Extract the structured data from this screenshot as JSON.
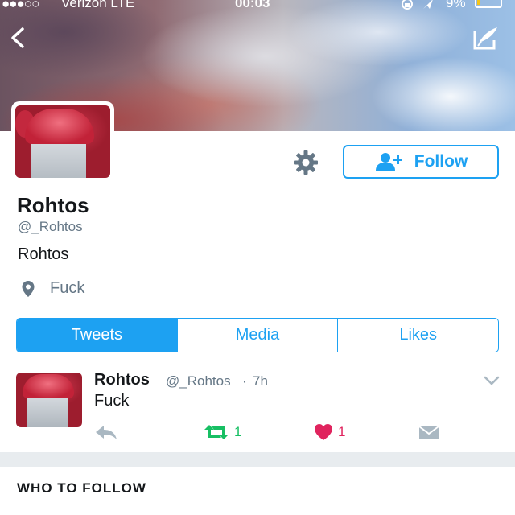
{
  "status_bar": {
    "signal": "●●●○○",
    "carrier": "Verizon  LTE",
    "time": "00:03",
    "battery": "9%"
  },
  "profile": {
    "display_name": "Rohtos",
    "handle": "@_Rohtos",
    "bio": "Rohtos",
    "location": "Fuck",
    "follow_label": "Follow"
  },
  "tabs": [
    {
      "label": "Tweets",
      "active": true
    },
    {
      "label": "Media",
      "active": false
    },
    {
      "label": "Likes",
      "active": false
    }
  ],
  "tweet": {
    "author": "Rohtos",
    "handle": "@_Rohtos",
    "separator": "·",
    "time": "7h",
    "text": "Fuck",
    "retweets": "1",
    "likes": "1"
  },
  "who_to_follow": "WHO TO FOLLOW",
  "colors": {
    "accent": "#1da1f2",
    "retweet": "#17bf63",
    "like": "#e0245e",
    "muted": "#657786"
  },
  "icons": [
    "back-arrow-icon",
    "compose-icon",
    "gear-icon",
    "add-user-icon",
    "location-pin-icon",
    "chevron-down-icon",
    "reply-icon",
    "retweet-icon",
    "heart-icon",
    "envelope-icon"
  ]
}
